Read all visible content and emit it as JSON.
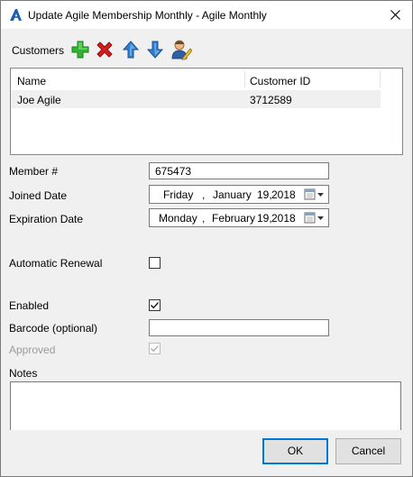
{
  "window": {
    "title": "Update Agile Membership Monthly - Agile Monthly",
    "close_glyph": "✕"
  },
  "customers": {
    "label": "Customers",
    "toolbar_icons": [
      "add-icon",
      "delete-icon",
      "move-up-icon",
      "move-down-icon",
      "edit-customer-icon"
    ],
    "columns": [
      "Name",
      "Customer ID"
    ],
    "rows": [
      {
        "name": "Joe Agile",
        "customer_id": "3712589"
      }
    ]
  },
  "member_number": {
    "label": "Member #",
    "value": "675473"
  },
  "joined_date": {
    "label": "Joined Date",
    "weekday": "Friday",
    "sep": ",",
    "month": "January",
    "day": "19,",
    "year": "2018"
  },
  "expiration_date": {
    "label": "Expiration Date",
    "weekday": "Monday",
    "sep": ",",
    "month": "February",
    "day": "19,",
    "year": "2018"
  },
  "automatic_renewal": {
    "label": "Automatic Renewal",
    "checked": false
  },
  "enabled": {
    "label": "Enabled",
    "checked": true
  },
  "barcode": {
    "label": "Barcode (optional)",
    "value": ""
  },
  "approved": {
    "label": "Approved",
    "checked": true,
    "disabled": true
  },
  "notes": {
    "label": "Notes",
    "value": ""
  },
  "buttons": {
    "ok": "OK",
    "cancel": "Cancel"
  },
  "colors": {
    "accent": "#0078d7",
    "add": "#2fb52f",
    "delete": "#d42020",
    "arrow": "#2f7fd0"
  }
}
